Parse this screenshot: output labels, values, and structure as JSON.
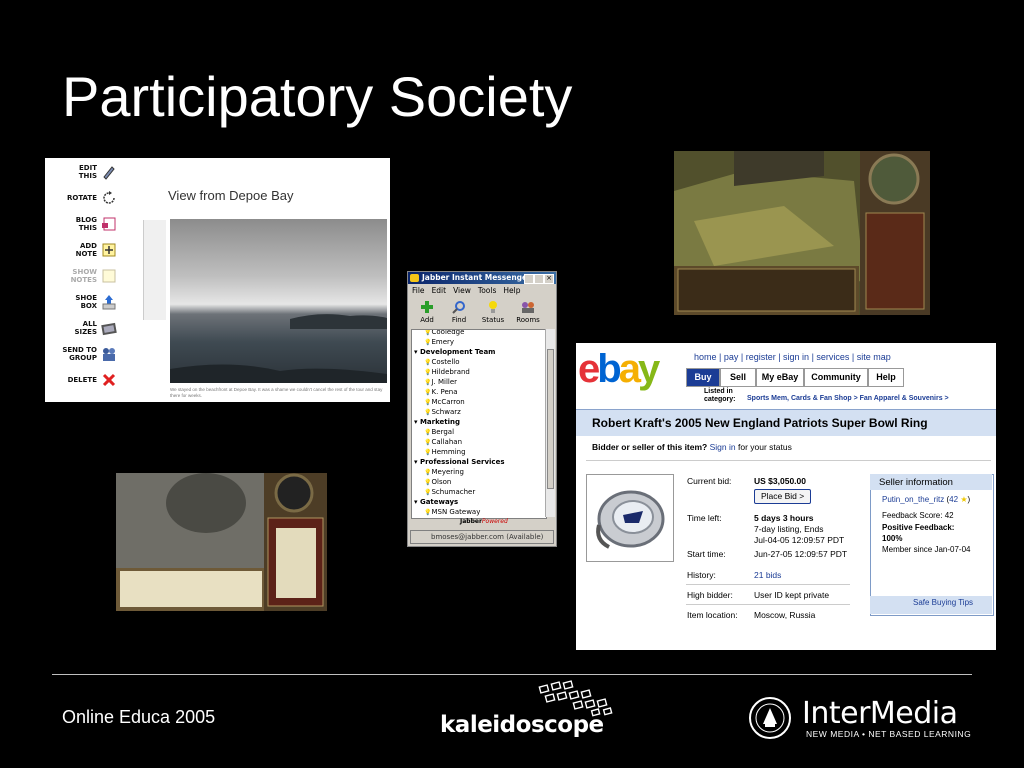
{
  "slide": {
    "title": "Participatory Society",
    "footer": "Online Educa 2005"
  },
  "flickr": {
    "actions": [
      {
        "label": "EDIT\nTHIS",
        "icon": "pencil-icon"
      },
      {
        "label": "ROTATE",
        "icon": "rotate-icon"
      },
      {
        "label": "BLOG\nTHIS",
        "icon": "blog-icon"
      },
      {
        "label": "ADD\nNOTE",
        "icon": "note-icon"
      },
      {
        "label": "SHOW\nNOTES",
        "icon": "notes-icon"
      },
      {
        "label": "SHOE\nBOX",
        "icon": "shoebox-icon"
      },
      {
        "label": "ALL\nSIZES",
        "icon": "sizes-icon"
      },
      {
        "label": "SEND TO\nGROUP",
        "icon": "group-icon"
      },
      {
        "label": "DELETE",
        "icon": "delete-icon"
      }
    ],
    "photo_title": "View from Depoe Bay",
    "caption": "We stayed on the beachfront at Depoe Bay. It was a shame we couldn't cancel the rest of the tour and stay there for weeks."
  },
  "jabber": {
    "title": "Jabber Instant Messenger",
    "menu": [
      "File",
      "Edit",
      "View",
      "Tools",
      "Help"
    ],
    "toolbar": [
      {
        "label": "Add",
        "icon": "add-contact-icon"
      },
      {
        "label": "Find",
        "icon": "find-icon"
      },
      {
        "label": "Status",
        "icon": "status-bulb-icon"
      },
      {
        "label": "Rooms",
        "icon": "rooms-icon"
      }
    ],
    "roster": [
      {
        "text": "Cooledge",
        "group": false
      },
      {
        "text": "Emery",
        "group": false
      },
      {
        "text": "Development Team",
        "group": true
      },
      {
        "text": "Costello",
        "group": false
      },
      {
        "text": "Hildebrand",
        "group": false
      },
      {
        "text": "J. Miller",
        "group": false
      },
      {
        "text": "K. Pena",
        "group": false
      },
      {
        "text": "McCarron",
        "group": false
      },
      {
        "text": "Schwarz",
        "group": false
      },
      {
        "text": "Marketing",
        "group": true
      },
      {
        "text": "Bergal",
        "group": false
      },
      {
        "text": "Callahan",
        "group": false
      },
      {
        "text": "Hemming",
        "group": false
      },
      {
        "text": "Professional Services",
        "group": true
      },
      {
        "text": "Meyering",
        "group": false
      },
      {
        "text": "Olson",
        "group": false
      },
      {
        "text": "Schumacher",
        "group": false
      },
      {
        "text": "Gateways",
        "group": true
      },
      {
        "text": "MSN Gateway",
        "group": false
      }
    ],
    "powered_brand": "Jabber",
    "powered_word": "Powered",
    "status": "bmoses@jabber.com (Available)"
  },
  "ebay": {
    "logo_letters": [
      "e",
      "b",
      "a",
      "y"
    ],
    "logo_colors": [
      "#e53238",
      "#0064d2",
      "#f5af02",
      "#86b817"
    ],
    "top_nav": "home | pay | register | sign in | services | site map",
    "tabs": [
      "Buy",
      "Sell",
      "My eBay",
      "Community",
      "Help"
    ],
    "listed_label": "Listed in\ncategory:",
    "category": "Sports Mem, Cards & Fan Shop > Fan Apparel & Souvenirs >",
    "item_title": "Robert Kraft's 2005 New England Patriots Super Bowl Ring",
    "bidder_prefix": "Bidder or seller of this item?",
    "sign_in": "Sign in",
    "bidder_suffix": "for your status",
    "place_bid": "Place Bid >",
    "details": [
      {
        "label": "Current bid:",
        "value": "US $3,050.00"
      },
      {
        "label": "Time left:",
        "value": "5 days 3 hours\n7-day listing, Ends\nJul-04-05 12:09:57 PDT"
      },
      {
        "label": "Start time:",
        "value": "Jun-27-05 12:09:57 PDT"
      },
      {
        "label": "History:",
        "value": "21 bids"
      },
      {
        "label": "High bidder:",
        "value": "User ID kept private"
      },
      {
        "label": "Item location:",
        "value": "Moscow, Russia"
      }
    ],
    "seller": {
      "heading": "Seller information",
      "name": "Putin_on_the_ritz",
      "score_link": "42",
      "feedback_score": "Feedback Score: 42",
      "positive_label": "Positive Feedback:",
      "positive_value": "100%",
      "member_since": "Member since Jan-07-04",
      "safe_tips": "Safe Buying Tips"
    }
  },
  "logos": {
    "kaleidoscope": "kaleidoscope",
    "intermedia": "InterMedia",
    "intermedia_tagline": "NEW MEDIA • NET BASED LEARNING"
  }
}
